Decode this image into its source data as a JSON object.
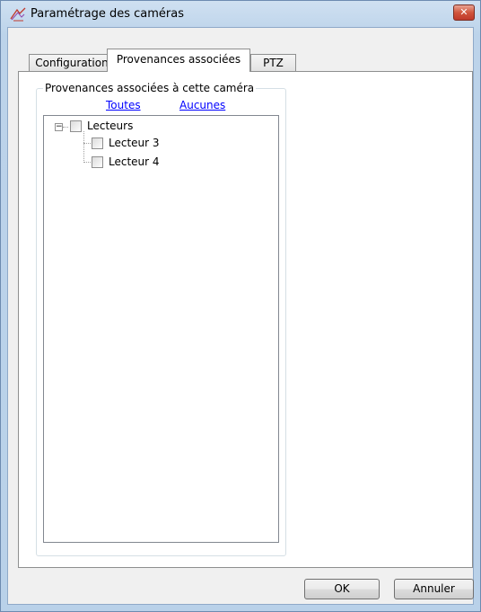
{
  "window": {
    "title": "Paramétrage des caméras",
    "close_glyph": "✕"
  },
  "tabs": [
    {
      "label": "Configuration",
      "active": false
    },
    {
      "label": "Provenances associées",
      "active": true
    },
    {
      "label": "PTZ",
      "active": false
    }
  ],
  "group": {
    "legend": "Provenances associées à cette caméra",
    "links": {
      "all": "Toutes",
      "none": "Aucunes"
    }
  },
  "tree": {
    "root": {
      "label": "Lecteurs",
      "expander": "−",
      "checked": false
    },
    "children": [
      {
        "label": "Lecteur 3",
        "checked": false
      },
      {
        "label": "Lecteur 4",
        "checked": false
      }
    ]
  },
  "buttons": {
    "ok": "OK",
    "cancel": "Annuler"
  },
  "icons": {
    "app": "camera-settings-icon",
    "close": "close-icon"
  }
}
